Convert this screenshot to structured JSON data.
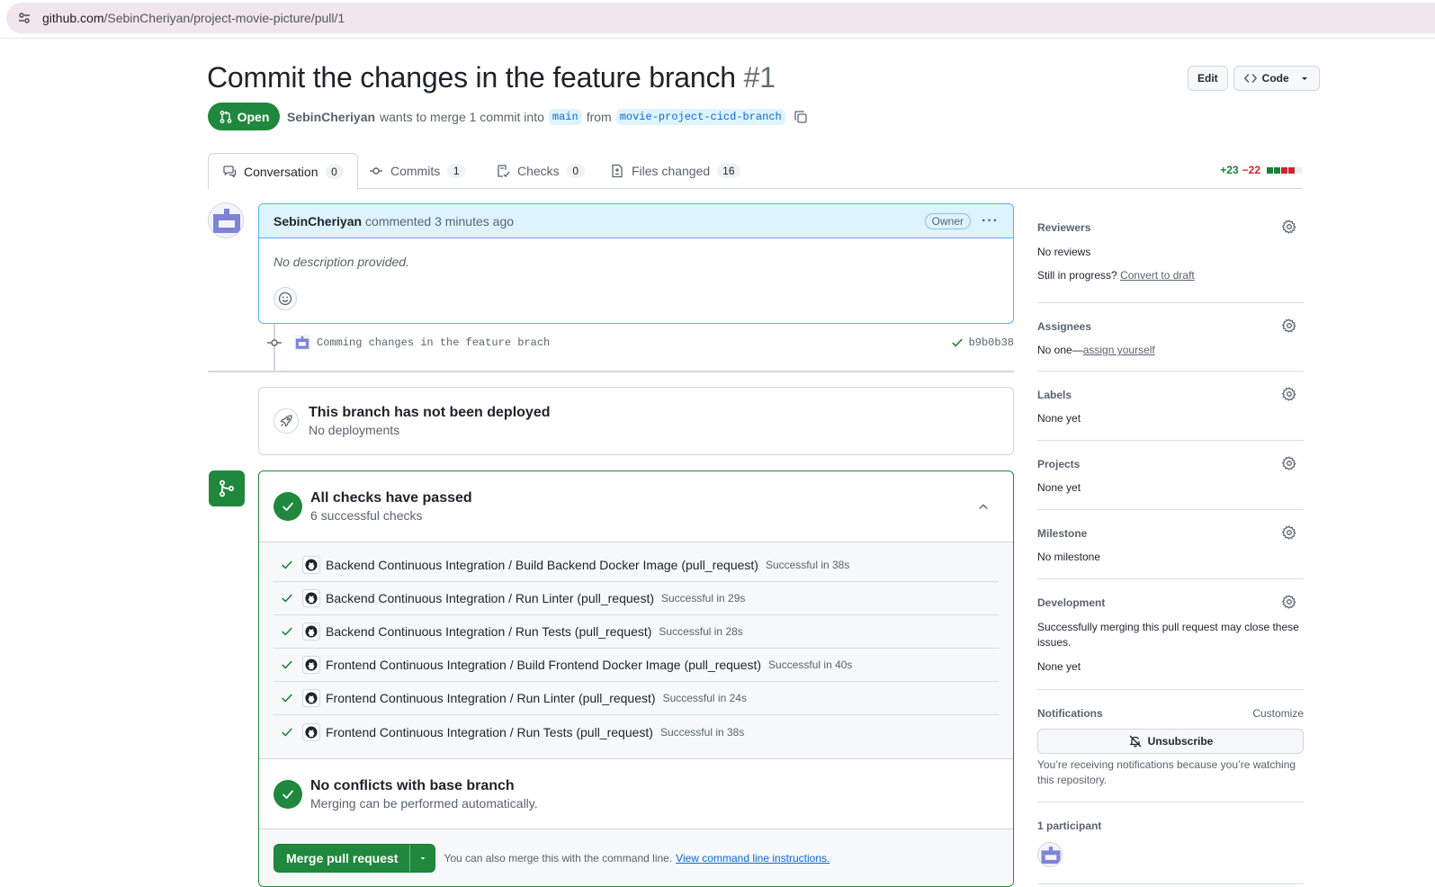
{
  "browser": {
    "url_host": "github.com",
    "url_path": "/SebinCheriyan/project-movie-picture/pull/1"
  },
  "pr": {
    "title": "Commit the changes in the feature branch",
    "number": "#1",
    "state": "Open",
    "author": "SebinCheriyan",
    "meta_text": "wants to merge 1 commit into",
    "base_branch": "main",
    "from_text": "from",
    "head_branch": "movie-project-cicd-branch"
  },
  "header_buttons": {
    "edit": "Edit",
    "code": "Code"
  },
  "tabs": [
    {
      "label": "Conversation",
      "count": "0"
    },
    {
      "label": "Commits",
      "count": "1"
    },
    {
      "label": "Checks",
      "count": "0"
    },
    {
      "label": "Files changed",
      "count": "16"
    }
  ],
  "diffstat": {
    "additions": "+23",
    "deletions": "−22",
    "colors": {
      "add": "#1a7f37",
      "del": "#d1242f",
      "neutral": "#d0d7de"
    }
  },
  "comment": {
    "author": "SebinCheriyan",
    "action": "commented 3 minutes ago",
    "badge": "Owner",
    "body": "No description provided."
  },
  "commit": {
    "message": "Comming changes in the feature brach",
    "sha": "b9b0b38"
  },
  "deployment": {
    "title": "This branch has not been deployed",
    "subtitle": "No deployments"
  },
  "checks": {
    "title": "All checks have passed",
    "subtitle": "6 successful checks",
    "items": [
      {
        "name": "Backend Continuous Integration / Build Backend Docker Image (pull_request)",
        "status": "Successful in 38s"
      },
      {
        "name": "Backend Continuous Integration / Run Linter (pull_request)",
        "status": "Successful in 29s"
      },
      {
        "name": "Backend Continuous Integration / Run Tests (pull_request)",
        "status": "Successful in 28s"
      },
      {
        "name": "Frontend Continuous Integration / Build Frontend Docker Image (pull_request)",
        "status": "Successful in 40s"
      },
      {
        "name": "Frontend Continuous Integration / Run Linter (pull_request)",
        "status": "Successful in 24s"
      },
      {
        "name": "Frontend Continuous Integration / Run Tests (pull_request)",
        "status": "Successful in 38s"
      }
    ]
  },
  "conflicts": {
    "title": "No conflicts with base branch",
    "subtitle": "Merging can be performed automatically."
  },
  "merge": {
    "button": "Merge pull request",
    "hint": "You can also merge this with the command line.",
    "link": "View command line instructions."
  },
  "sidebar": {
    "reviewers": {
      "title": "Reviewers",
      "value": "No reviews",
      "progress_q": "Still in progress?",
      "progress_link": "Convert to draft"
    },
    "assignees": {
      "title": "Assignees",
      "value": "No one—",
      "link": "assign yourself"
    },
    "labels": {
      "title": "Labels",
      "value": "None yet"
    },
    "projects": {
      "title": "Projects",
      "value": "None yet"
    },
    "milestone": {
      "title": "Milestone",
      "value": "No milestone"
    },
    "development": {
      "title": "Development",
      "desc": "Successfully merging this pull request may close these issues.",
      "value": "None yet"
    },
    "notifications": {
      "title": "Notifications",
      "customize": "Customize",
      "button": "Unsubscribe",
      "note": "You’re receiving notifications because you’re watching this repository."
    },
    "participants": {
      "title": "1 participant"
    }
  }
}
